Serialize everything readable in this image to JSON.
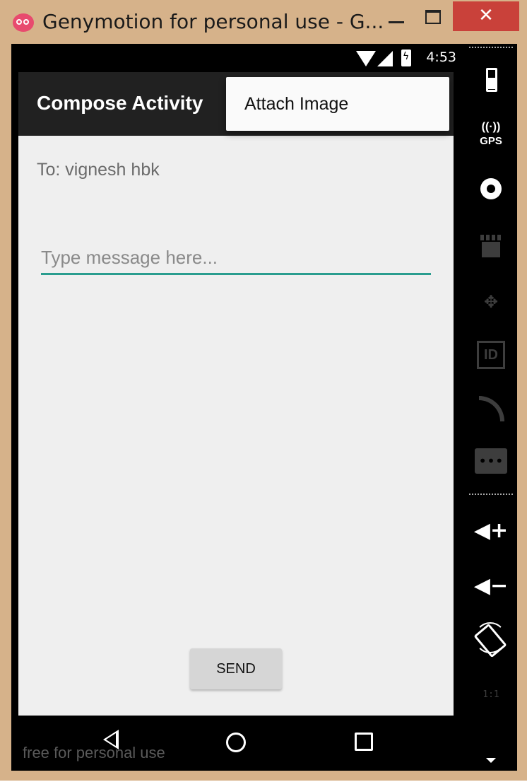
{
  "window": {
    "title": "Genymotion for personal use - G...",
    "close_glyph": "✕",
    "colors": {
      "frame": "#d6b28a",
      "close": "#c9413a"
    }
  },
  "status_bar": {
    "time": "4:53"
  },
  "app_bar": {
    "title": "Compose Activity"
  },
  "overflow_menu": {
    "items": [
      {
        "label": "Attach Image"
      }
    ]
  },
  "compose": {
    "to_text": "To: vignesh hbk",
    "message_placeholder": "Type message here...",
    "message_value": "",
    "send_label": "SEND",
    "accent_color": "#2a9d8f"
  },
  "nav_bar": {
    "watermark": "free for personal use"
  },
  "side_toolbar": {
    "tools": [
      {
        "name": "battery-icon"
      },
      {
        "name": "gps-icon",
        "label": "GPS"
      },
      {
        "name": "webcam-icon"
      },
      {
        "name": "capture-icon"
      },
      {
        "name": "dpad-icon",
        "glyph": "✥"
      },
      {
        "name": "identifiers-icon"
      },
      {
        "name": "cast-icon"
      },
      {
        "name": "sms-icon"
      },
      {
        "name": "volume-up-icon",
        "glyph": "◀+"
      },
      {
        "name": "volume-down-icon",
        "glyph": "◀−"
      },
      {
        "name": "rotate-icon"
      },
      {
        "name": "pixel-perfect-icon",
        "label": "1:1"
      },
      {
        "name": "more-icon"
      }
    ]
  }
}
